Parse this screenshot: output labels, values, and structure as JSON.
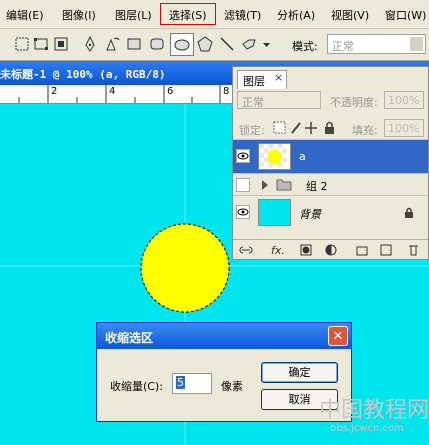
{
  "menu": {
    "items": [
      "编辑(E)",
      "图像(I)",
      "图层(L)",
      "选择(S)",
      "滤镜(T)",
      "分析(A)",
      "视图(V)",
      "窗口(W)"
    ],
    "highlighted_index": 3
  },
  "toolbar": {
    "mode_label": "模式:",
    "mode_value": "正常",
    "icons": [
      "marquee-icon",
      "path-icon",
      "pen-icon",
      "freeform-pen-icon",
      "rectangle-icon",
      "rounded-rectangle-icon",
      "ellipse-icon",
      "polygon-icon",
      "line-icon",
      "custom-shape-icon"
    ]
  },
  "document": {
    "title": "未标题-1 @ 100% (a, RGB/8)",
    "ruler_marks": [
      "2",
      "4",
      "6",
      "8"
    ]
  },
  "layers_panel": {
    "tab_label": "图层",
    "close_glyph": "×",
    "blend_mode": "正常",
    "opacity_label": "不透明度:",
    "opacity_value": "100%",
    "lock_label": "锁定:",
    "fill_label": "填充:",
    "fill_value": "100%",
    "layers": [
      {
        "name": "a",
        "visible": true,
        "active": true
      },
      {
        "name": "组 2",
        "visible": false,
        "active": false
      },
      {
        "name": "背景",
        "visible": true,
        "active": false
      }
    ]
  },
  "dialog": {
    "title": "收缩选区",
    "close_glyph": "✕",
    "shrink_label": "收缩量(C):",
    "shrink_value": "5",
    "unit": "像素",
    "ok_label": "确定",
    "cancel_label": "取消"
  },
  "watermark": {
    "text": "中国教程网",
    "url": "bbs.jcwcn.com"
  },
  "colors": {
    "canvas": "#00e5ee",
    "circle": "#ffff00",
    "accent": "#0b55d5"
  }
}
